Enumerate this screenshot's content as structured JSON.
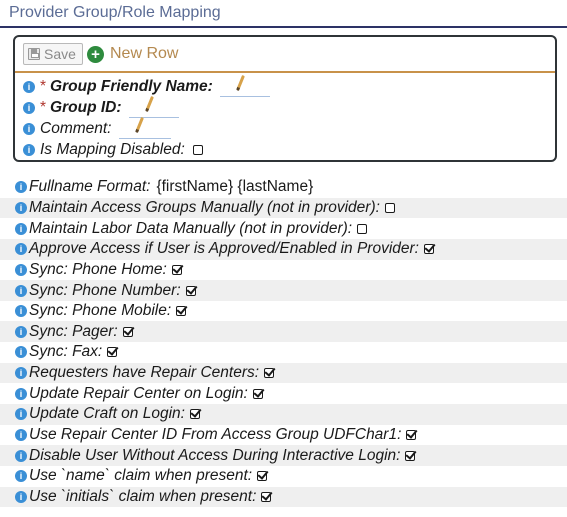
{
  "header": {
    "title": "Provider Group/Role Mapping"
  },
  "toolbar": {
    "save_label": "Save",
    "new_row_label": "New Row"
  },
  "form": {
    "required_mark": "*",
    "fields": [
      {
        "label": "Group Friendly Name:"
      },
      {
        "label": "Group ID:"
      },
      {
        "label": "Comment:"
      },
      {
        "label": "Is Mapping Disabled:"
      }
    ]
  },
  "settings": [
    {
      "label": "Fullname Format:",
      "value": "{firstName} {lastName}"
    },
    {
      "label": "Maintain Access Groups Manually (not in provider):",
      "checked": false
    },
    {
      "label": "Maintain Labor Data Manually (not in provider):",
      "checked": false
    },
    {
      "label": "Approve Access if User is Approved/Enabled in Provider:",
      "checked": true
    },
    {
      "label": "Sync: Phone Home:",
      "checked": true
    },
    {
      "label": "Sync: Phone Number:",
      "checked": true
    },
    {
      "label": "Sync: Phone Mobile:",
      "checked": true
    },
    {
      "label": "Sync: Pager:",
      "checked": true
    },
    {
      "label": "Sync: Fax:",
      "checked": true
    },
    {
      "label": "Requesters have Repair Centers:",
      "checked": true
    },
    {
      "label": "Update Repair Center on Login:",
      "checked": true
    },
    {
      "label": "Update Craft on Login:",
      "checked": true
    },
    {
      "label": "Use Repair Center ID From Access Group UDFChar1:",
      "checked": true
    },
    {
      "label": "Disable User Without Access During Interactive Login:",
      "checked": true
    },
    {
      "label": "Use `name` claim when present:",
      "checked": true
    },
    {
      "label": "Use `initials` claim when present:",
      "checked": true
    }
  ]
}
